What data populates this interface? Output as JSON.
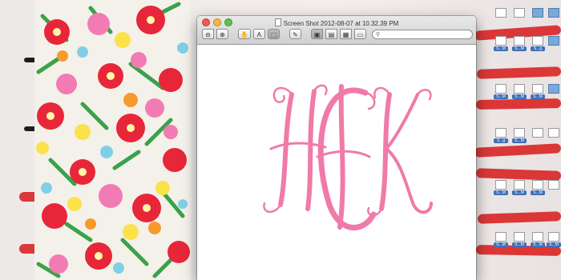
{
  "window": {
    "title": "Screen Shot 2012-08-07 at 10.32.39 PM",
    "toolbar": {
      "zoom_out": "⊖",
      "zoom_in": "⊕",
      "move": "✋",
      "text_select": "A",
      "select_rect": "⬚",
      "edit": "✎",
      "view_single": "▣",
      "view_sidebar": "▤",
      "view_grid": "▦",
      "view_fullscreen": "▭"
    },
    "search_icon": "⚲"
  },
  "document": {
    "monogram": "HCK",
    "monogram_color": "#f07aa8"
  },
  "desktop": {
    "icon_labels": [
      "S...M",
      "S...M",
      "S...g",
      "S...M",
      "S...M",
      "S...M",
      "S...g",
      "S...M",
      "S...M",
      "S...M",
      "S...M",
      "S...M",
      "S...M",
      "S...M",
      "S...M"
    ]
  },
  "colors": {
    "red_stroke": "#d92828",
    "window_chrome": "#d6d6d6"
  }
}
